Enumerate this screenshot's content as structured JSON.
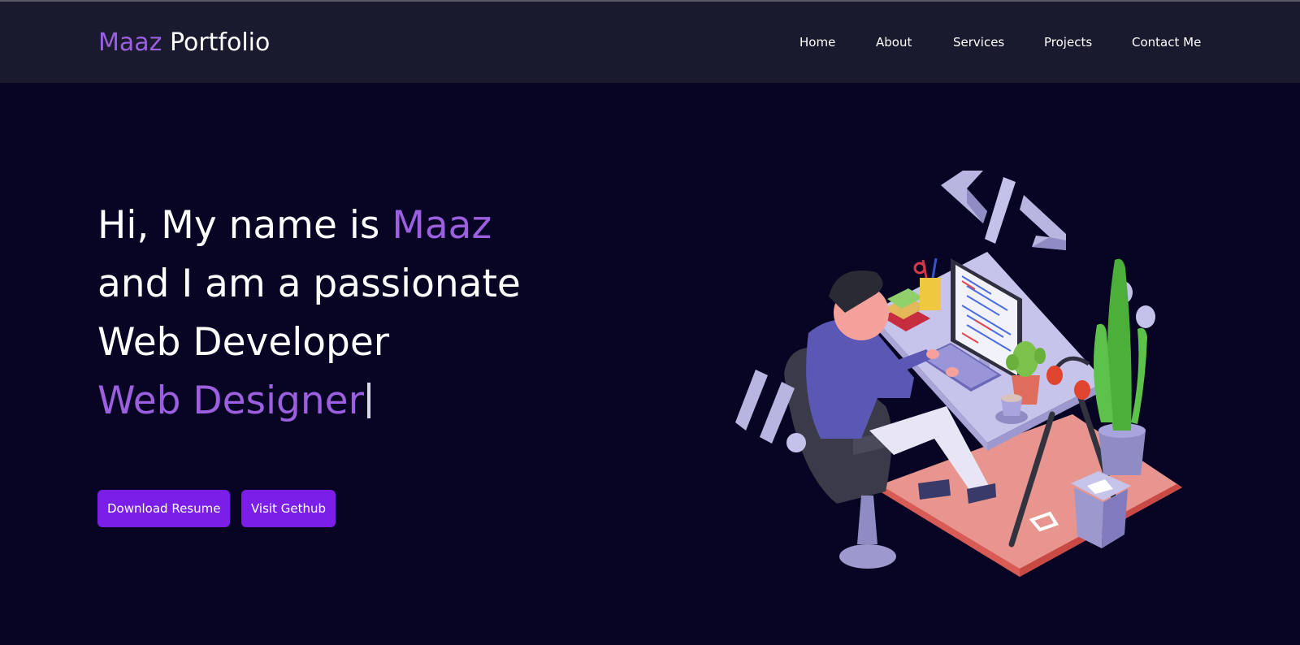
{
  "brand": {
    "accent": "Maaz",
    "rest": " Portfolio"
  },
  "nav": {
    "items": [
      "Home",
      "About",
      "Services",
      "Projects",
      "Contact Me"
    ]
  },
  "hero": {
    "line1_prefix": "Hi, My name is ",
    "line1_name": "Maaz",
    "line2": "and I am a passionate",
    "line3": "Web Developer",
    "typed": "Web Designer"
  },
  "buttons": {
    "resume": "Download Resume",
    "github": "Visit Gethub"
  },
  "illustration": {
    "code_tag": "</>"
  },
  "colors": {
    "background": "#070523",
    "navbar": "#1a1a2e",
    "accent": "#9b5fe0",
    "button": "#7b1fe8"
  }
}
